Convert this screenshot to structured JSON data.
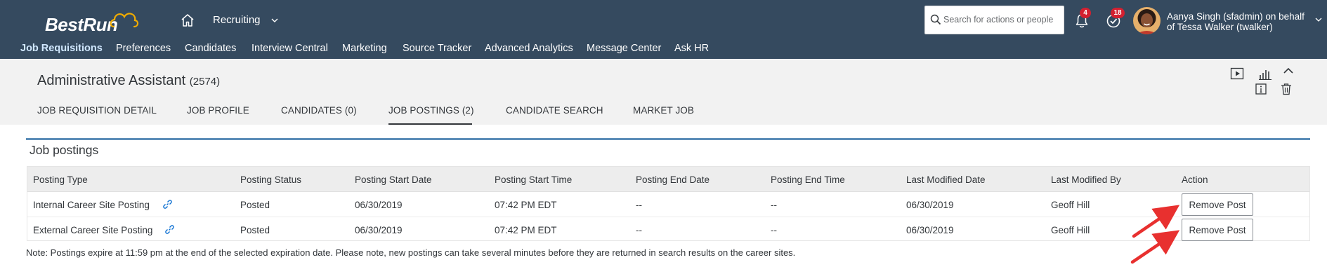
{
  "shell": {
    "logo_text": "BestRun",
    "app_title": "Recruiting",
    "search_placeholder": "Search for actions or people",
    "notification_count": "4",
    "todo_count": "18",
    "user_name": "Aanya Singh (sfadmin) on behalf of Tessa Walker (twalker)"
  },
  "nav": {
    "items": [
      {
        "label": "Job Requisitions",
        "active": true
      },
      {
        "label": "Preferences"
      },
      {
        "label": "Candidates"
      },
      {
        "label": "Interview Central"
      },
      {
        "label": "Marketing"
      },
      {
        "label": "Source Tracker"
      },
      {
        "label": "Advanced Analytics"
      },
      {
        "label": "Message Center"
      },
      {
        "label": "Ask HR"
      }
    ]
  },
  "object": {
    "title": "Administrative Assistant",
    "id_text": "(2574)",
    "tabs": [
      {
        "label": "JOB REQUISITION DETAIL"
      },
      {
        "label": "JOB PROFILE"
      },
      {
        "label": "CANDIDATES (0)"
      },
      {
        "label": "JOB POSTINGS (2)",
        "selected": true
      },
      {
        "label": "CANDIDATE SEARCH"
      },
      {
        "label": "MARKET JOB"
      }
    ],
    "icons": [
      "play-icon",
      "analytics-icon",
      "collapse-icon",
      "info-icon",
      "delete-icon"
    ]
  },
  "postings": {
    "section_title": "Job postings",
    "columns": [
      "Posting Type",
      "Posting Status",
      "Posting Start Date",
      "Posting Start Time",
      "Posting End Date",
      "Posting End Time",
      "Last Modified Date",
      "Last Modified By",
      "Action"
    ],
    "rows": [
      {
        "type": "Internal Career Site Posting",
        "status": "Posted",
        "start_date": "06/30/2019",
        "start_time": "07:42 PM EDT",
        "end_date": "--",
        "end_time": "--",
        "modified_date": "06/30/2019",
        "modified_by": "Geoff Hill",
        "action": "Remove Post"
      },
      {
        "type": "External Career Site Posting",
        "status": "Posted",
        "start_date": "06/30/2019",
        "start_time": "07:42 PM EDT",
        "end_date": "--",
        "end_time": "--",
        "modified_date": "06/30/2019",
        "modified_by": "Geoff Hill",
        "action": "Remove Post"
      }
    ],
    "note": "Note: Postings expire at 11:59 pm at the end of the selected expiration date. Please note, new postings can take several minutes before they are returned in search results on the career sites."
  },
  "colors": {
    "shell_bg": "#354a5f",
    "badge": "#d32030",
    "accent_line": "#5b8db8",
    "arrow": "#e8302f"
  }
}
